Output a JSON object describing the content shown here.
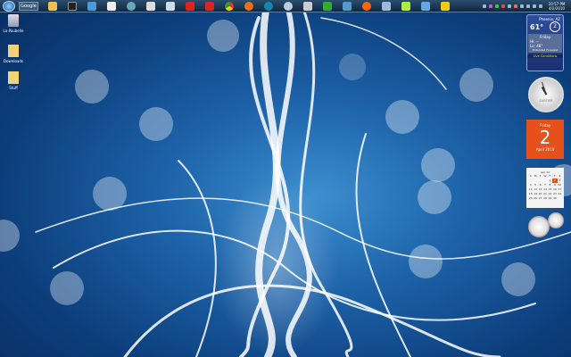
{
  "taskbar": {
    "search_label": "Google",
    "icons": [
      "folder",
      "cmd",
      "display",
      "notepad",
      "browser",
      "window",
      "file",
      "gmail",
      "gmail",
      "chrome",
      "firefox",
      "app",
      "app",
      "app",
      "utorrent",
      "media",
      "player",
      "doc",
      "chat",
      "virtualbox",
      "network"
    ],
    "clock_time": "10:57 PM",
    "clock_date": "4/2/2010"
  },
  "desktop": {
    "icons": [
      {
        "label": "La Poubelle",
        "icon": "recycle-bin"
      },
      {
        "label": "Downloads",
        "icon": "folder"
      },
      {
        "label": "Stuff",
        "icon": "folder"
      }
    ]
  },
  "weather": {
    "city": "Phoenix, AZ",
    "temp": "61°",
    "wind": "2",
    "day": "Friday",
    "hi": "Hi: --",
    "lo": "Lo: 48°",
    "extended": "Extended Forecast",
    "live": "Live Conditions"
  },
  "clock_gadget": {
    "brand": "CARTIER"
  },
  "calendar": {
    "weekday": "Friday",
    "day": "2",
    "month_year": "April 2010"
  },
  "mini_calendar": {
    "title": "Apr 10",
    "headers": [
      "S",
      "M",
      "T",
      "W",
      "T",
      "F",
      "S"
    ],
    "days": [
      "",
      "",
      "",
      "",
      "1",
      "2",
      "3",
      "4",
      "5",
      "6",
      "7",
      "8",
      "9",
      "10",
      "11",
      "12",
      "13",
      "14",
      "15",
      "16",
      "17",
      "18",
      "19",
      "20",
      "21",
      "22",
      "23",
      "24",
      "25",
      "26",
      "27",
      "28",
      "29",
      "30",
      ""
    ],
    "selected": "2"
  },
  "colors": {
    "accent": "#e5501b"
  }
}
